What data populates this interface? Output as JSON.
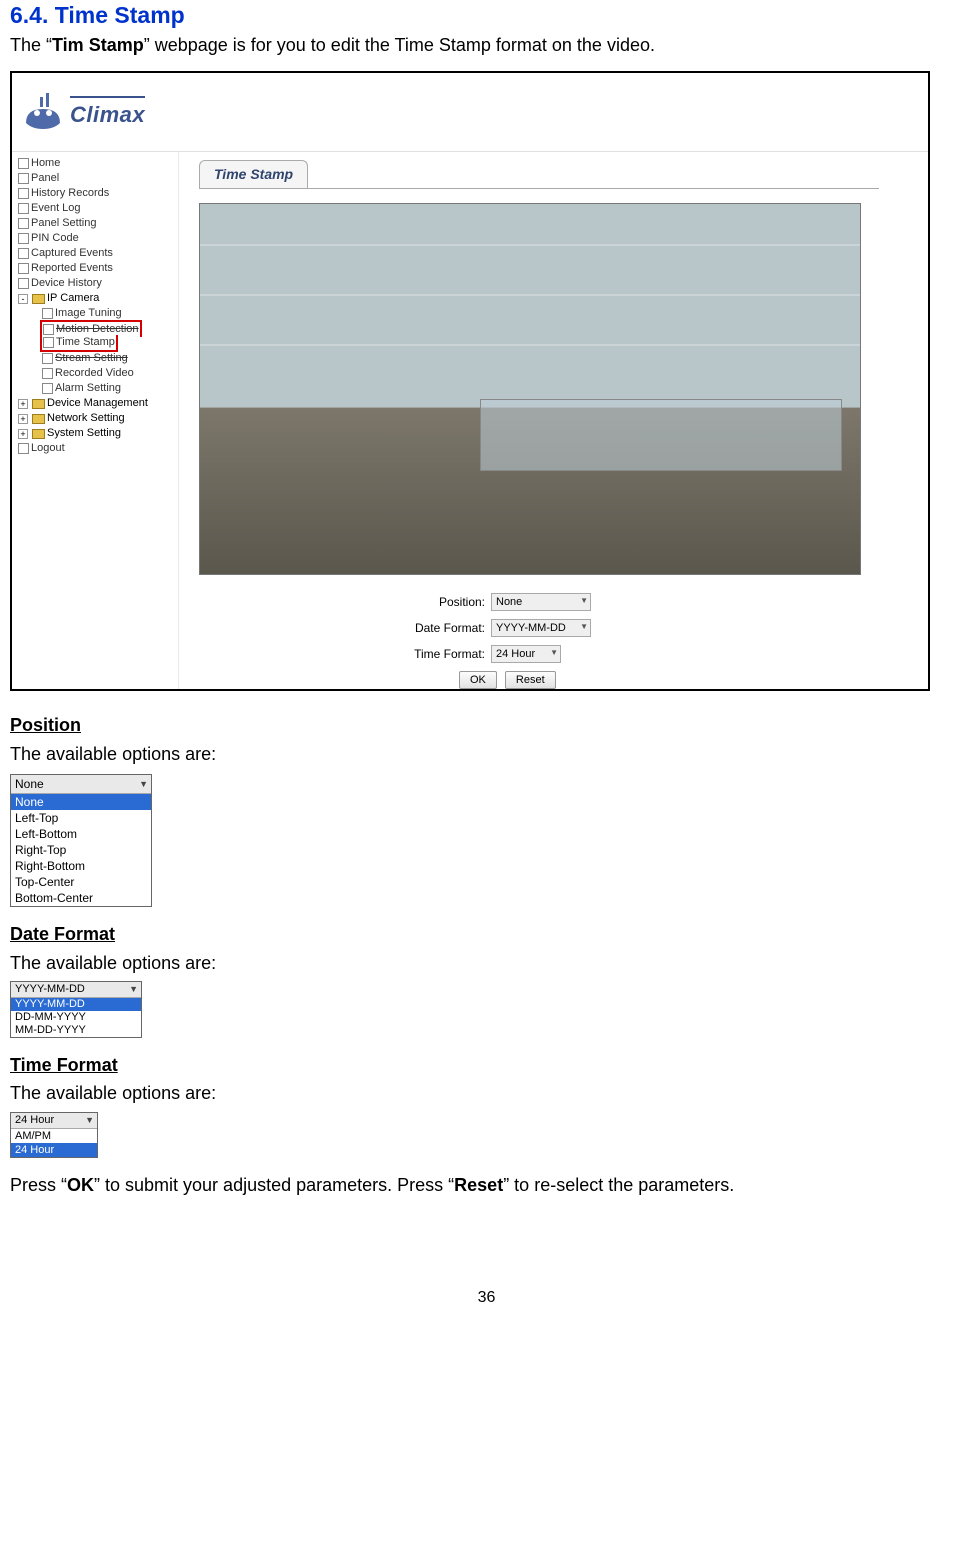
{
  "heading": "6.4. Time Stamp",
  "intro_prefix": "The “",
  "intro_bold": "Tim Stamp",
  "intro_suffix": "” webpage is for you to edit the Time Stamp format on the video.",
  "screenshot": {
    "logo_text": "Climax",
    "nav_items": [
      "Home",
      "Panel",
      "History Records",
      "Event Log",
      "Panel Setting",
      "PIN Code",
      "Captured Events",
      "Reported Events",
      "Device History"
    ],
    "nav_ipcamera_label": "IP Camera",
    "nav_ipcamera_children": [
      "Image Tuning",
      "Motion Detection",
      "Time Stamp",
      "Stream Setting",
      "Recorded Video",
      "Alarm Setting"
    ],
    "nav_folders": [
      "Device Management",
      "Network Setting",
      "System Setting"
    ],
    "nav_logout": "Logout",
    "tab_label": "Time Stamp",
    "form": {
      "position_label": "Position:",
      "position_value": "None",
      "date_label": "Date Format:",
      "date_value": "YYYY-MM-DD",
      "time_label": "Time Format:",
      "time_value": "24 Hour",
      "ok": "OK",
      "reset": "Reset"
    }
  },
  "position": {
    "title": "Position",
    "text": "The available options are:",
    "top": "None",
    "options": [
      "None",
      "Left-Top",
      "Left-Bottom",
      "Right-Top",
      "Right-Bottom",
      "Top-Center",
      "Bottom-Center"
    ]
  },
  "date": {
    "title": "Date Format",
    "text": "The available options are:",
    "top": "YYYY-MM-DD",
    "options": [
      "YYYY-MM-DD",
      "DD-MM-YYYY",
      "MM-DD-YYYY"
    ]
  },
  "time": {
    "title": "Time Format",
    "text": "The available options are:",
    "top": "24 Hour",
    "options": [
      "AM/PM",
      "24 Hour"
    ]
  },
  "closing_1": "Press “",
  "closing_ok": "OK",
  "closing_2": "” to submit your adjusted parameters. Press “",
  "closing_reset": "Reset",
  "closing_3": "” to re-select the parameters.",
  "page_number": "36"
}
